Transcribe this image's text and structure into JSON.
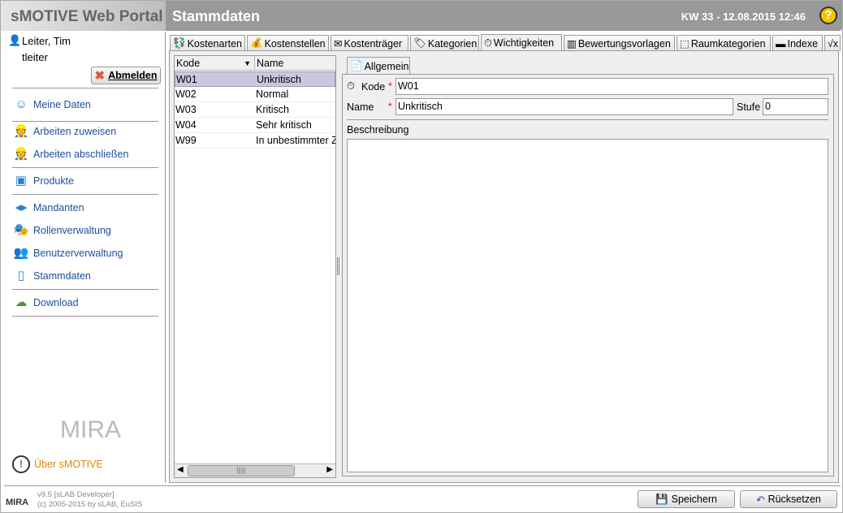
{
  "header": {
    "app_title": "sMOTIVE Web Portal",
    "page_title": "Stammdaten",
    "datetime": "KW 33 - 12.08.2015 12:46",
    "help_symbol": "?"
  },
  "user": {
    "name": "Leiter, Tim",
    "login": "tleiter",
    "logout_label": "Abmelden"
  },
  "sidebar": {
    "items": [
      {
        "label": "Meine Daten",
        "icon": "user-card-icon"
      },
      {
        "label": "Arbeiten zuweisen",
        "icon": "worker-icon"
      },
      {
        "label": "Arbeiten abschließen",
        "icon": "worker-done-icon"
      },
      {
        "label": "Produkte",
        "icon": "product-icon"
      },
      {
        "label": "Mandanten",
        "icon": "tenant-icon"
      },
      {
        "label": "Rollenverwaltung",
        "icon": "roles-icon"
      },
      {
        "label": "Benutzerverwaltung",
        "icon": "users-icon"
      },
      {
        "label": "Stammdaten",
        "icon": "tablet-icon"
      },
      {
        "label": "Download",
        "icon": "cloud-download-icon"
      }
    ],
    "logo_text": "MIRA",
    "about_label": "Über sMOTIVE"
  },
  "tabs": [
    {
      "label": "Kostenarten"
    },
    {
      "label": "Kostenstellen"
    },
    {
      "label": "Kostenträger"
    },
    {
      "label": "Kategorien"
    },
    {
      "label": "Wichtigkeiten",
      "active": true
    },
    {
      "label": "Bewertungsvorlagen"
    },
    {
      "label": "Raumkategorien"
    },
    {
      "label": "Indexe"
    },
    {
      "label": "√x"
    }
  ],
  "list": {
    "columns": [
      "Kode",
      "Name"
    ],
    "rows": [
      {
        "kode": "W01",
        "name": "Unkritisch",
        "selected": true
      },
      {
        "kode": "W02",
        "name": "Normal"
      },
      {
        "kode": "W03",
        "name": "Kritisch"
      },
      {
        "kode": "W04",
        "name": "Sehr kritisch"
      },
      {
        "kode": "W99",
        "name": "In unbestimmter Zeit"
      }
    ]
  },
  "detail": {
    "tab": "Allgemein",
    "kode_label": "Kode",
    "kode_value": "W01",
    "name_label": "Name",
    "name_value": "Unkritisch",
    "stufe_label": "Stufe",
    "stufe_value": "0",
    "beschreibung_label": "Beschreibung",
    "beschreibung_value": ""
  },
  "footer": {
    "version": "v9.5 [sLAB Developer]",
    "copyright": "(c) 2005-2015 by sLAB, EuSIS",
    "logo_text": "MIRA",
    "save_label": "Speichern",
    "reset_label": "Rücksetzen"
  },
  "colors": {
    "header_bg": "#999999",
    "link": "#1d4f9a",
    "about": "#e08a00",
    "selection": "#c8c8e0"
  }
}
